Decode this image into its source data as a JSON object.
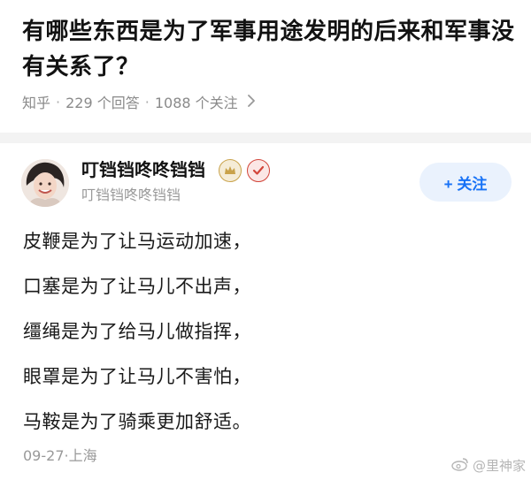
{
  "question": {
    "title": "有哪些东西是为了军事用途发明的后来和军事没有关系了？",
    "source": "知乎",
    "answers": "229 个回答",
    "followers": "1088 个关注",
    "separator": "·",
    "chevron_icon": "chevron-right-icon"
  },
  "answer": {
    "author_name": "叮铛铛咚咚铛铛",
    "author_subtitle": "叮铛铛咚咚铛铛",
    "badges": [
      "crown-badge-icon",
      "verified-check-icon"
    ],
    "follow_button": "+ 关注",
    "lines": [
      "皮鞭是为了让马运动加速，",
      "口塞是为了让马儿不出声，",
      "缰绳是为了给马儿做指挥，",
      "眼罩是为了让马儿不害怕，",
      "马鞍是为了骑乘更加舒适。"
    ],
    "date_location": "09-27·上海"
  },
  "watermark": {
    "text": "@里神家"
  },
  "colors": {
    "accent": "#1772f6",
    "follow_bg": "#eaf2fd",
    "meta_text": "#8a8a8a",
    "divider_band": "#f3f3f3",
    "crown_badge": "#c9a24a",
    "verified_badge": "#d2453a"
  }
}
